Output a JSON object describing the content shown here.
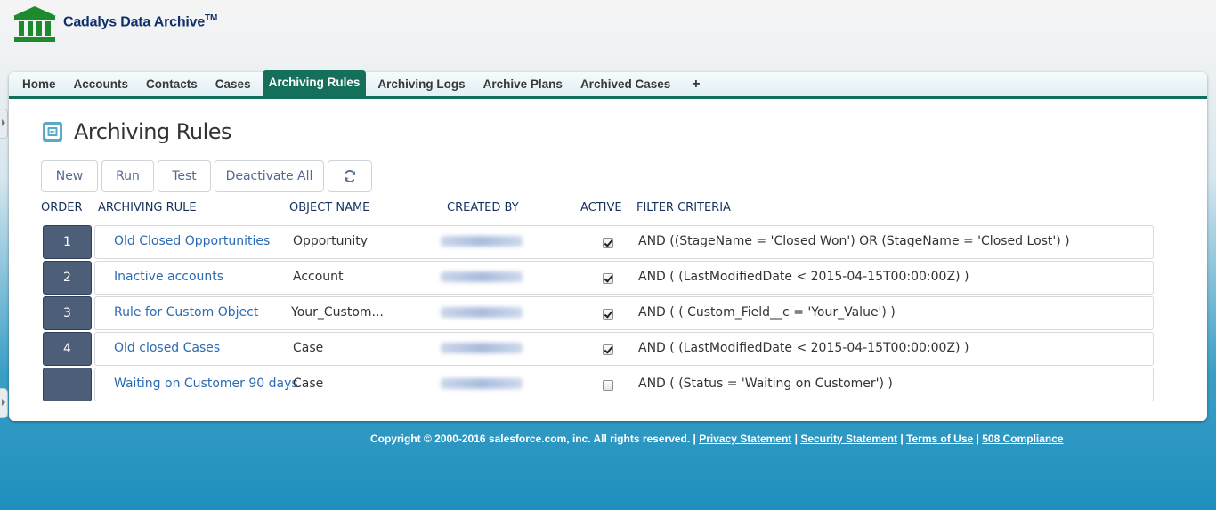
{
  "app": {
    "name": "Cadalys Data Archive",
    "trademark": "TM"
  },
  "tabs": [
    {
      "label": "Home",
      "active": false
    },
    {
      "label": "Accounts",
      "active": false
    },
    {
      "label": "Contacts",
      "active": false
    },
    {
      "label": "Cases",
      "active": false
    },
    {
      "label": "Archiving Rules",
      "active": true
    },
    {
      "label": "Archiving Logs",
      "active": false
    },
    {
      "label": "Archive Plans",
      "active": false
    },
    {
      "label": "Archived Cases",
      "active": false
    },
    {
      "label": "+",
      "active": false
    }
  ],
  "page": {
    "title": "Archiving Rules",
    "icon": "archive-rules-icon"
  },
  "toolbar": {
    "new_label": "New",
    "run_label": "Run",
    "test_label": "Test",
    "deactivate_all_label": "Deactivate All",
    "refresh_icon": "refresh-icon"
  },
  "table": {
    "headers": {
      "order": "ORDER",
      "rule": "ARCHIVING RULE",
      "object": "OBJECT NAME",
      "created_by": "CREATED BY",
      "active": "ACTIVE",
      "filter": "FILTER CRITERIA"
    },
    "rows": [
      {
        "order": "1",
        "rule": "Old Closed Opportunities",
        "object": "Opportunity",
        "created_by": "",
        "active": true,
        "filter": "AND ((StageName = 'Closed Won') OR (StageName = 'Closed Lost') )"
      },
      {
        "order": "2",
        "rule": "Inactive accounts",
        "object": "Account",
        "created_by": "",
        "active": true,
        "filter": "AND ( (LastModifiedDate < 2015-04-15T00:00:00Z) )"
      },
      {
        "order": "3",
        "rule": "Rule for Custom Object",
        "object": "Your_Custom...",
        "created_by": "",
        "active": true,
        "filter": "AND ( ( Custom_Field__c = 'Your_Value') )"
      },
      {
        "order": "4",
        "rule": "Old closed Cases",
        "object": "Case",
        "created_by": "",
        "active": true,
        "filter": "AND ( (LastModifiedDate < 2015-04-15T00:00:00Z) )"
      },
      {
        "order": "",
        "rule": "Waiting on Customer 90 days",
        "object": "Case",
        "created_by": "",
        "active": false,
        "filter": "AND ( (Status = 'Waiting on Customer') )"
      }
    ]
  },
  "footer": {
    "copyright": "Copyright © 2000-2016 salesforce.com, inc. All rights reserved. | ",
    "privacy": "Privacy Statement",
    "security": "Security Statement",
    "terms": "Terms of Use",
    "compliance": "508 Compliance",
    "separator": " | "
  },
  "colors": {
    "tab_active": "#15705b",
    "order_badge": "#4c5e78",
    "link": "#2b6bb3",
    "brand": "#10306d"
  }
}
